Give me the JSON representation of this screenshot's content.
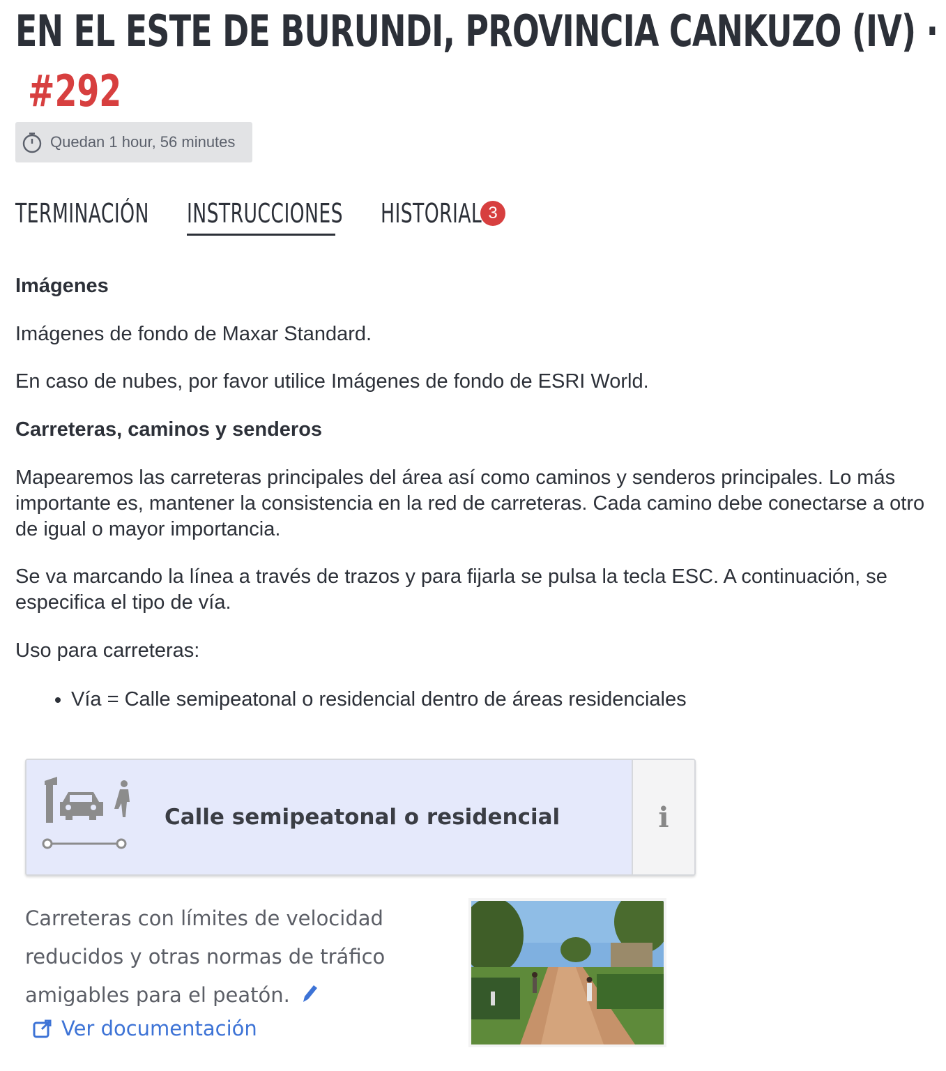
{
  "header": {
    "title": "EN EL ESTE DE BURUNDI, PROVINCIA CANKUZO (IV) ·",
    "task_number": "#292",
    "timer_text": "Quedan 1 hour, 56 minutes"
  },
  "tabs": [
    {
      "label": "TERMINACIÓN",
      "active": false
    },
    {
      "label": "INSTRUCCIONES",
      "active": true
    },
    {
      "label": "HISTORIAL",
      "active": false,
      "badge": "3"
    }
  ],
  "instructions": {
    "imagery_heading": "Imágenes",
    "imagery_p1": "Imágenes de fondo de Maxar Standard.",
    "imagery_p2": "En caso de nubes, por favor utilice Imágenes de fondo de ESRI World.",
    "roads_heading": "Carreteras, caminos y senderos",
    "roads_p1": "Mapearemos las carreteras principales del área así como caminos y senderos principales. Lo más importante es, mantener la consistencia en la red de carreteras. Cada camino debe conectarse a otro de igual o mayor importancia.",
    "roads_p2": "Se va marcando la línea a través de trazos y para fijarla se pulsa la tecla ESC. A continuación, se especifica el tipo de vía.",
    "usage_label": "Uso para carreteras:",
    "bullets": [
      "Vía = Calle semipeatonal o residencial dentro de áreas residenciales"
    ]
  },
  "preset_card": {
    "icon": "residential-road-icon",
    "label": "Calle semipeatonal o residencial",
    "info_symbol": "i",
    "description": "Carreteras con límites de velocidad reducidos y otras normas de tráfico amigables para el peatón.",
    "doc_link": "Ver documentación"
  },
  "colors": {
    "accent_red": "#d73f3f",
    "link_blue": "#3d73d6",
    "card_bg": "#e5e9fb"
  }
}
